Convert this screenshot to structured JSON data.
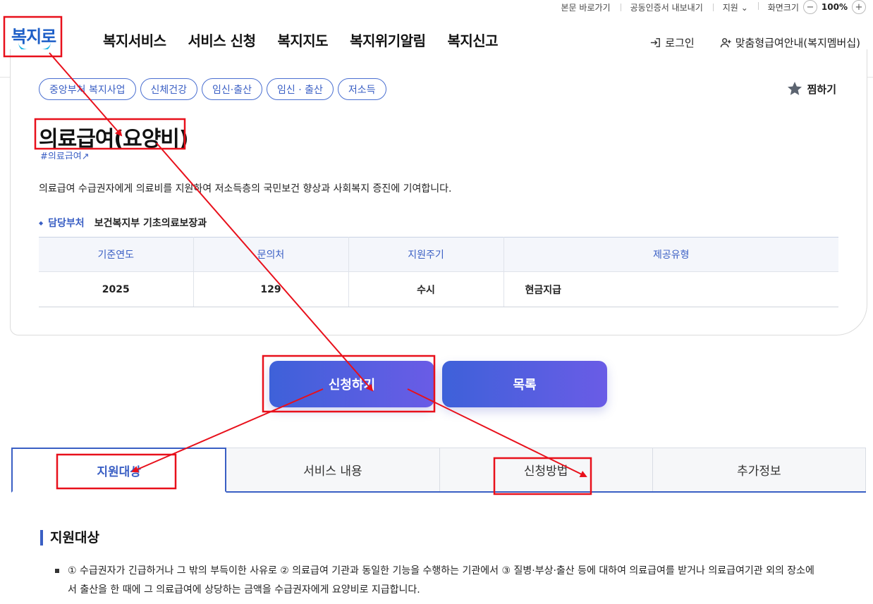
{
  "utility": {
    "skip": "본문 바로가기",
    "cert": "공동인증서 내보내기",
    "support": "지원",
    "screen_size": "화면크기",
    "zoom": "100%",
    "zoom_out": "−",
    "zoom_in": "+"
  },
  "header": {
    "logo": "복지로",
    "nav": [
      "복지서비스",
      "서비스 신청",
      "복지지도",
      "복지위기알림",
      "복지신고"
    ],
    "login": "로그인",
    "membership": "맞춤형급여안내(복지멤버십)"
  },
  "service": {
    "tags": [
      "중앙부처 복지사업",
      "신체건강",
      "임신·출산",
      "임신 · 출산",
      "저소득"
    ],
    "favorite": "찜하기",
    "title": "의료급여(요양비)",
    "hashtag": "#의료급여",
    "description": "의료급여 수급권자에게 의료비를 지원하여 저소득층의 국민보건 향상과 사회복지 증진에 기여합니다.",
    "department_label": "담당부처",
    "department_value": "보건복지부 기초의료보장과",
    "table": {
      "headers": [
        "기준연도",
        "문의처",
        "지원주기",
        "제공유형"
      ],
      "row": [
        "2025",
        "129",
        "수시",
        "현금지급"
      ]
    }
  },
  "actions": {
    "apply": "신청하기",
    "list": "목록"
  },
  "tabs": [
    "지원대상",
    "서비스 내용",
    "신청방법",
    "추가정보"
  ],
  "section": {
    "title": "지원대상",
    "body": "① 수급권자가 긴급하거나 그 밖의 부득이한 사유로 ② 의료급여 기관과 동일한 기능을 수행하는 기관에서 ③ 질병·부상·출산 등에 대하여 의료급여를 받거나 의료급여기관 외의 장소에서 출산을 한 때에 그 의료급여에 상당하는 금액을 수급권자에게 요양비로 지급합니다."
  },
  "colors": {
    "accent": "#3a5fc4",
    "annotation": "#e8101b",
    "button_start": "#3e61d9",
    "button_end": "#6a5ce6"
  }
}
